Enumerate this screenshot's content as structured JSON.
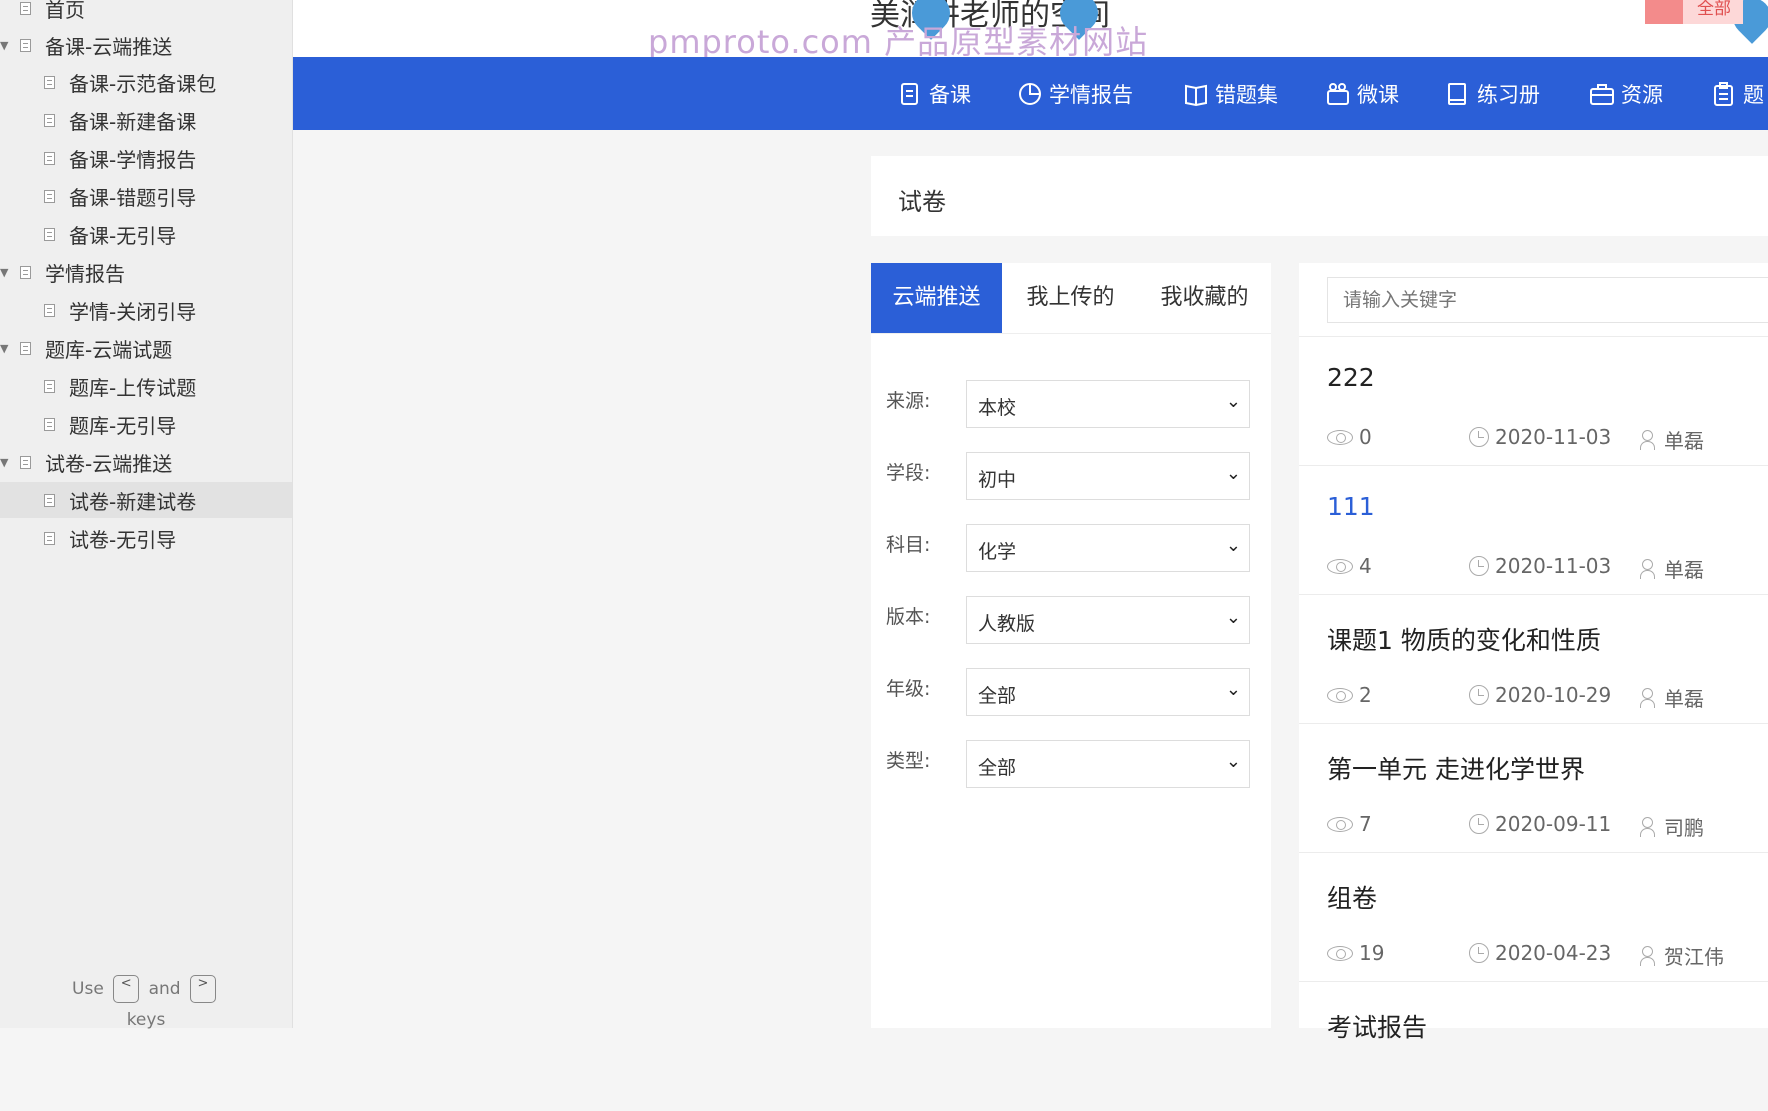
{
  "sidebar": {
    "items": [
      {
        "label": "首页",
        "level": 0,
        "arrow": false
      },
      {
        "label": "备课-云端推送",
        "level": 0,
        "arrow": true
      },
      {
        "label": "备课-示范备课包",
        "level": 1
      },
      {
        "label": "备课-新建备课",
        "level": 1
      },
      {
        "label": "备课-学情报告",
        "level": 1
      },
      {
        "label": "备课-错题引导",
        "level": 1
      },
      {
        "label": "备课-无引导",
        "level": 1
      },
      {
        "label": "学情报告",
        "level": 0,
        "arrow": true
      },
      {
        "label": "学情-关闭引导",
        "level": 1
      },
      {
        "label": "题库-云端试题",
        "level": 0,
        "arrow": true
      },
      {
        "label": "题库-上传试题",
        "level": 1
      },
      {
        "label": "题库-无引导",
        "level": 1
      },
      {
        "label": "试卷-云端推送",
        "level": 0,
        "arrow": true
      },
      {
        "label": "试卷-新建试卷",
        "level": 1,
        "selected": true
      },
      {
        "label": "试卷-无引导",
        "level": 1
      }
    ],
    "hint": {
      "use": "Use",
      "key_prev": "<",
      "and": "and",
      "key_next": ">",
      "keys": "keys"
    }
  },
  "header": {
    "site_title": "美润讲老师的空间",
    "watermark": "pmproto.com 产品原型素材网站",
    "red_label": "全部"
  },
  "nav": {
    "items": [
      {
        "label": "备课",
        "icon": "doc-icon"
      },
      {
        "label": "学情报告",
        "icon": "pie-chart-icon"
      },
      {
        "label": "错题集",
        "icon": "book-icon"
      },
      {
        "label": "微课",
        "icon": "video-icon"
      },
      {
        "label": "练习册",
        "icon": "notebook-icon"
      },
      {
        "label": "资源",
        "icon": "briefcase-icon"
      },
      {
        "label": "题",
        "icon": "clipboard-icon"
      }
    ]
  },
  "content": {
    "title": "试卷",
    "tabs": [
      "云端推送",
      "我上传的",
      "我收藏的"
    ],
    "active_tab": 0,
    "filters": [
      {
        "label": "来源:",
        "value": "本校"
      },
      {
        "label": "学段:",
        "value": "初中"
      },
      {
        "label": "科目:",
        "value": "化学"
      },
      {
        "label": "版本:",
        "value": "人教版"
      },
      {
        "label": "年级:",
        "value": "全部"
      },
      {
        "label": "类型:",
        "value": "全部"
      }
    ],
    "search": {
      "placeholder": "请输入关键字"
    },
    "list": [
      {
        "title": "222",
        "views": "0",
        "date": "2020-11-03",
        "author": "单磊",
        "link": false
      },
      {
        "title": "111",
        "views": "4",
        "date": "2020-11-03",
        "author": "单磊",
        "link": true
      },
      {
        "title": "课题1 物质的变化和性质",
        "views": "2",
        "date": "2020-10-29",
        "author": "单磊",
        "link": false
      },
      {
        "title": "第一单元 走进化学世界",
        "views": "7",
        "date": "2020-09-11",
        "author": "司鹏",
        "link": false
      },
      {
        "title": "组卷",
        "views": "19",
        "date": "2020-04-23",
        "author": "贺江伟",
        "link": false
      },
      {
        "title": "考试报告",
        "views": "",
        "date": "",
        "author": "",
        "link": false
      }
    ]
  }
}
